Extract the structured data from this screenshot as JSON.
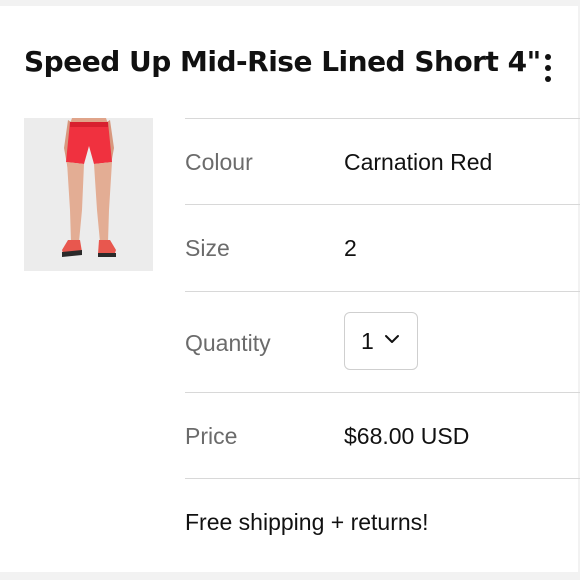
{
  "product": {
    "title": "Speed Up Mid-Rise Lined Short 4\"",
    "image": "product-photo-red-shorts"
  },
  "details": {
    "colour_label": "Colour",
    "colour_value": "Carnation Red",
    "size_label": "Size",
    "size_value": "2",
    "quantity_label": "Quantity",
    "quantity_value": "1",
    "price_label": "Price",
    "price_value": "$68.00 USD",
    "shipping_note": "Free shipping + returns!"
  },
  "icons": {
    "menu": "more-vertical-icon",
    "quantity_dropdown": "chevron-down-icon"
  },
  "colors": {
    "product_red": "#f0313f",
    "label_gray": "#6b6b6b",
    "divider": "#d8d8d8"
  }
}
